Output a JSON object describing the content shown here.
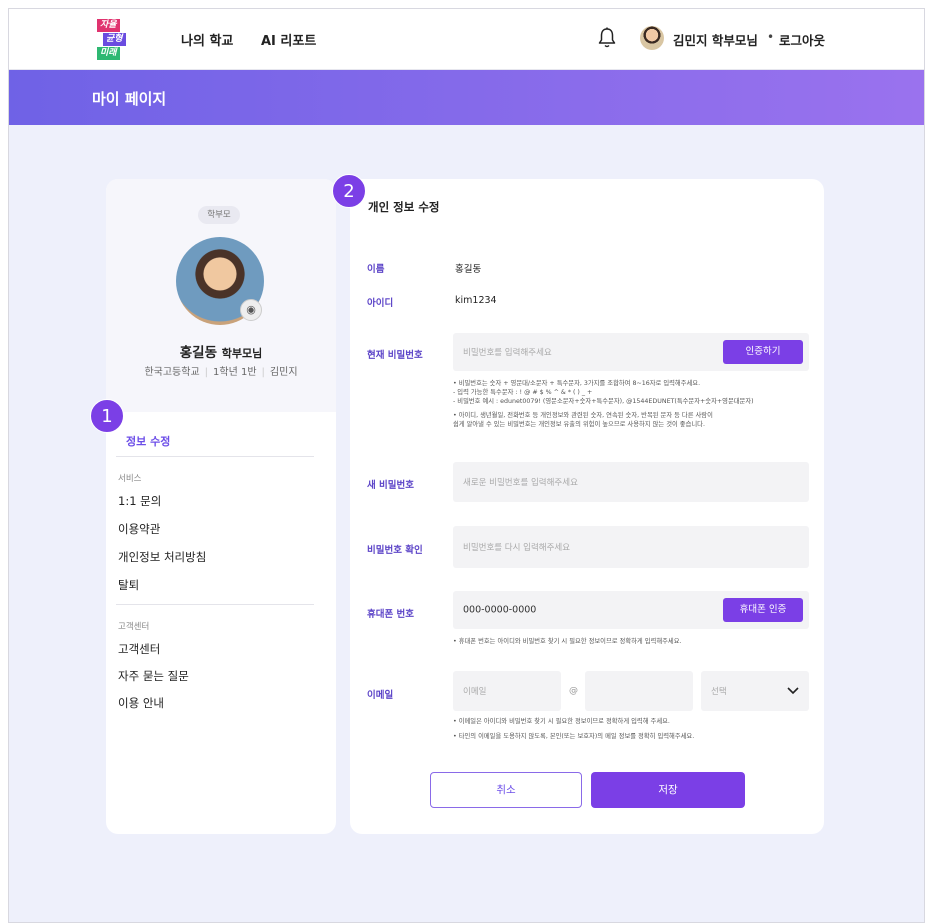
{
  "header": {
    "logo": [
      "자율",
      "균형",
      "미래"
    ],
    "nav": [
      "나의 학교",
      "AI 리포트"
    ],
    "user_name": "김민지 학부모님",
    "separator": "•",
    "logout": "로그아웃"
  },
  "banner": {
    "title": "마이 페이지"
  },
  "markers": [
    "1",
    "2"
  ],
  "sidebar": {
    "role_badge": "학부모",
    "name": "홍길동",
    "name_suffix": "학부모님",
    "school": "한국고등학교",
    "grade": "1학년 1반",
    "child": "김민지",
    "active_menu": "정보 수정",
    "section_service": "서비스",
    "service_items": [
      "1:1 문의",
      "이용약관",
      "개인정보 처리방침",
      "탈퇴"
    ],
    "section_support": "고객센터",
    "support_items": [
      "고객센터",
      "자주 묻는 질문",
      "이용 안내"
    ]
  },
  "form": {
    "title": "개인 정보 수정",
    "name_label": "이름",
    "name_value": "홍길동",
    "id_label": "아이디",
    "id_value": "kim1234",
    "current_pw_label": "현재 비밀번호",
    "current_pw_placeholder": "비밀번호를 입력해주세요",
    "verify_button": "인증하기",
    "pw_notes": [
      "• 비밀번호는 숫자 + 영문대/소문자 + 특수문자, 3가지를 조합하여 8~16자로 입력해주세요.",
      "  - 입력 가능한 특수문자 : ! @ # $ % ^ & * ( ) _ +",
      "  - 비밀번호 예시 : edunet0079! (영문소문자+숫자+특수문자), @1544EDUNET(특수문자+숫자+영문대문자)",
      "• 아이디, 생년월일, 전화번호 등 개인정보와 관련된 숫자, 연속된 숫자, 반복된 문자 등 다른 사람이",
      "  쉽게 알아낼 수 있는 비밀번호는 개인정보 유출의 위험이 높으므로 사용하지 않는 것이 좋습니다."
    ],
    "new_pw_label": "새 비밀번호",
    "new_pw_placeholder": "새로운 비밀번호를 입력해주세요",
    "confirm_pw_label": "비밀번호 확인",
    "confirm_pw_placeholder": "비밀번호를 다시 입력해주세요",
    "phone_label": "휴대폰 번호",
    "phone_value": "000-0000-0000",
    "phone_button": "휴대폰 인증",
    "phone_note": "• 휴대폰 번호는 아이디와 비밀번호 찾기 시 필요한 정보이므로 정확하게 입력해주세요.",
    "email_label": "이메일",
    "email_placeholder": "이메일",
    "email_at": "@",
    "email_domain": "",
    "email_select": "선택",
    "email_notes": [
      "• 이메일은 아이디와 비밀번호 찾기 시 필요한 정보이므로 정확하게 입력해 주세요.",
      "• 타인의 이메일을 도용하지 않도록, 본인(또는 보호자)의 메일 정보를 정확히 입력해주세요."
    ],
    "cancel_button": "취소",
    "save_button": "저장"
  },
  "colors": {
    "accent": "#7b3fe6",
    "label": "#5d45c8",
    "banner_start": "#6f62e6",
    "banner_end": "#9a72ee"
  }
}
